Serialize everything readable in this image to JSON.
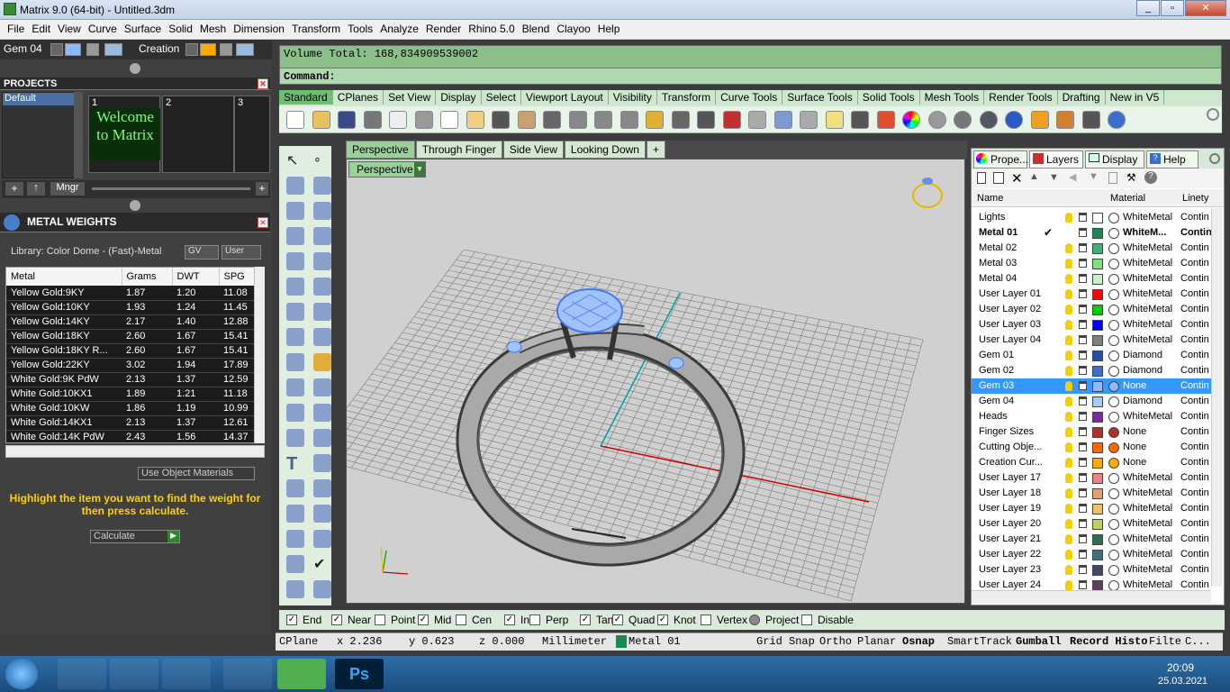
{
  "window": {
    "title": "Matrix 9.0 (64-bit) - Untitled.3dm"
  },
  "menu": [
    "File",
    "Edit",
    "View",
    "Curve",
    "Surface",
    "Solid",
    "Mesh",
    "Dimension",
    "Transform",
    "Tools",
    "Analyze",
    "Render",
    "Rhino 5.0",
    "Blend",
    "Clayoo",
    "Help"
  ],
  "left": {
    "gem_label": "Gem 04",
    "creation_label": "Creation",
    "projects_title": "PROJECTS",
    "project_selected": "Default",
    "thumb_nums": [
      "1",
      "2",
      "3"
    ],
    "welcome_text": "Welcome to Matrix",
    "mngr_label": "Mngr",
    "metal_title": "METAL WEIGHTS",
    "library_label": "Library: Color Dome - (Fast)-Metal",
    "gv_label": "GV",
    "user_label": "User",
    "table_headers": [
      "Metal",
      "Grams",
      "DWT",
      "SPG"
    ],
    "table_rows": [
      [
        "Yellow Gold:9KY",
        "1.87",
        "1.20",
        "11.08"
      ],
      [
        "Yellow Gold:10KY",
        "1.93",
        "1.24",
        "11.45"
      ],
      [
        "Yellow Gold:14KY",
        "2.17",
        "1.40",
        "12.88"
      ],
      [
        "Yellow Gold:18KY",
        "2.60",
        "1.67",
        "15.41"
      ],
      [
        "Yellow Gold:18KY R...",
        "2.60",
        "1.67",
        "15.41"
      ],
      [
        "Yellow Gold:22KY",
        "3.02",
        "1.94",
        "17.89"
      ],
      [
        "White Gold:9K PdW",
        "2.13",
        "1.37",
        "12.59"
      ],
      [
        "White Gold:10KX1",
        "1.89",
        "1.21",
        "11.18"
      ],
      [
        "White Gold:10KW",
        "1.86",
        "1.19",
        "10.99"
      ],
      [
        "White Gold:14KX1",
        "2.13",
        "1.37",
        "12.61"
      ],
      [
        "White Gold:14K PdW",
        "2.43",
        "1.56",
        "14.37"
      ]
    ],
    "use_object_materials": "Use Object Materials",
    "instruction": "Highlight the item you want to find the weight for then press calculate.",
    "calculate_label": "Calculate"
  },
  "command": {
    "line1": "Volume Total: 168,834909539002",
    "prompt": "Command:"
  },
  "toolbar_tabs": [
    "Standard",
    "CPlanes",
    "Set View",
    "Display",
    "Select",
    "Viewport Layout",
    "Visibility",
    "Transform",
    "Curve Tools",
    "Surface Tools",
    "Solid Tools",
    "Mesh Tools",
    "Render Tools",
    "Drafting",
    "New in V5"
  ],
  "view_tabs": [
    "Perspective",
    "Through Finger",
    "Side View",
    "Looking Down",
    "+"
  ],
  "viewport_label": "Perspective",
  "panel_tabs": [
    "Prope...",
    "Layers",
    "Display",
    "Help"
  ],
  "layer_headers": {
    "name": "Name",
    "material": "Material",
    "linetype": "Linety"
  },
  "layers": [
    {
      "name": "Lights",
      "color": "#ffffff",
      "mat": "WhiteMetal",
      "lt": "Contin"
    },
    {
      "name": "Metal 01",
      "color": "#1a8a50",
      "mat": "WhiteM...",
      "lt": "Contin",
      "current": true
    },
    {
      "name": "Metal 02",
      "color": "#3cb371",
      "mat": "WhiteMetal",
      "lt": "Contin"
    },
    {
      "name": "Metal 03",
      "color": "#7fe07f",
      "mat": "WhiteMetal",
      "lt": "Contin"
    },
    {
      "name": "Metal 04",
      "color": "#c8f0c8",
      "mat": "WhiteMetal",
      "lt": "Contin"
    },
    {
      "name": "User Layer 01",
      "color": "#ff0000",
      "mat": "WhiteMetal",
      "lt": "Contin"
    },
    {
      "name": "User Layer 02",
      "color": "#00cc00",
      "mat": "WhiteMetal",
      "lt": "Contin"
    },
    {
      "name": "User Layer 03",
      "color": "#0000ff",
      "mat": "WhiteMetal",
      "lt": "Contin"
    },
    {
      "name": "User Layer 04",
      "color": "#808080",
      "mat": "WhiteMetal",
      "lt": "Contin"
    },
    {
      "name": "Gem 01",
      "color": "#1f4fb0",
      "mat": "Diamond",
      "lt": "Contin"
    },
    {
      "name": "Gem 02",
      "color": "#3a6fd0",
      "mat": "Diamond",
      "lt": "Contin"
    },
    {
      "name": "Gem 03",
      "color": "#8fb8ff",
      "mat": "None",
      "lt": "Contin",
      "selected": true
    },
    {
      "name": "Gem 04",
      "color": "#a8c8f0",
      "mat": "Diamond",
      "lt": "Contin"
    },
    {
      "name": "Heads",
      "color": "#7a2aa0",
      "mat": "WhiteMetal",
      "lt": "Contin"
    },
    {
      "name": "Finger Sizes",
      "color": "#b03030",
      "mat": "None",
      "lt": "Contin"
    },
    {
      "name": "Cutting Obje...",
      "color": "#ff6600",
      "mat": "None",
      "lt": "Contin"
    },
    {
      "name": "Creation Cur...",
      "color": "#ffaa00",
      "mat": "None",
      "lt": "Contin"
    },
    {
      "name": "User Layer 17",
      "color": "#f08080",
      "mat": "WhiteMetal",
      "lt": "Contin"
    },
    {
      "name": "User Layer 18",
      "color": "#e0a070",
      "mat": "WhiteMetal",
      "lt": "Contin"
    },
    {
      "name": "User Layer 19",
      "color": "#f0c060",
      "mat": "WhiteMetal",
      "lt": "Contin"
    },
    {
      "name": "User Layer 20",
      "color": "#c0d060",
      "mat": "WhiteMetal",
      "lt": "Contin"
    },
    {
      "name": "User Layer 21",
      "color": "#2f6f4f",
      "mat": "WhiteMetal",
      "lt": "Contin"
    },
    {
      "name": "User Layer 22",
      "color": "#3f6f7f",
      "mat": "WhiteMetal",
      "lt": "Contin"
    },
    {
      "name": "User Layer 23",
      "color": "#404868",
      "mat": "WhiteMetal",
      "lt": "Contin"
    },
    {
      "name": "User Layer 24",
      "color": "#604060",
      "mat": "WhiteMetal",
      "lt": "Contin"
    }
  ],
  "osnap": [
    {
      "label": "End",
      "checked": true
    },
    {
      "label": "Near",
      "checked": true
    },
    {
      "label": "Point",
      "checked": false
    },
    {
      "label": "Mid",
      "checked": true
    },
    {
      "label": "Cen",
      "checked": false
    },
    {
      "label": "Int",
      "checked": true
    },
    {
      "label": "Perp",
      "checked": false
    },
    {
      "label": "Tan",
      "checked": true
    },
    {
      "label": "Quad",
      "checked": true
    },
    {
      "label": "Knot",
      "checked": true
    },
    {
      "label": "Vertex",
      "checked": false
    },
    {
      "label": "Project",
      "checked": true
    },
    {
      "label": "Disable",
      "checked": false
    }
  ],
  "status": {
    "cplane": "CPlane",
    "x": "x 2.236",
    "y": "y 0.623",
    "z": "z 0.000",
    "units": "Millimeters",
    "layer": "Metal 01",
    "grid": "Grid Snap",
    "ortho": "Ortho",
    "planar": "Planar",
    "osnap": "Osnap",
    "smarttrack": "SmartTrack",
    "gumball": "Gumball",
    "record": "Record Histo",
    "filter": "Filte",
    "more": "C..."
  },
  "taskbar": {
    "time": "20:09",
    "date": "25.03.2021"
  }
}
